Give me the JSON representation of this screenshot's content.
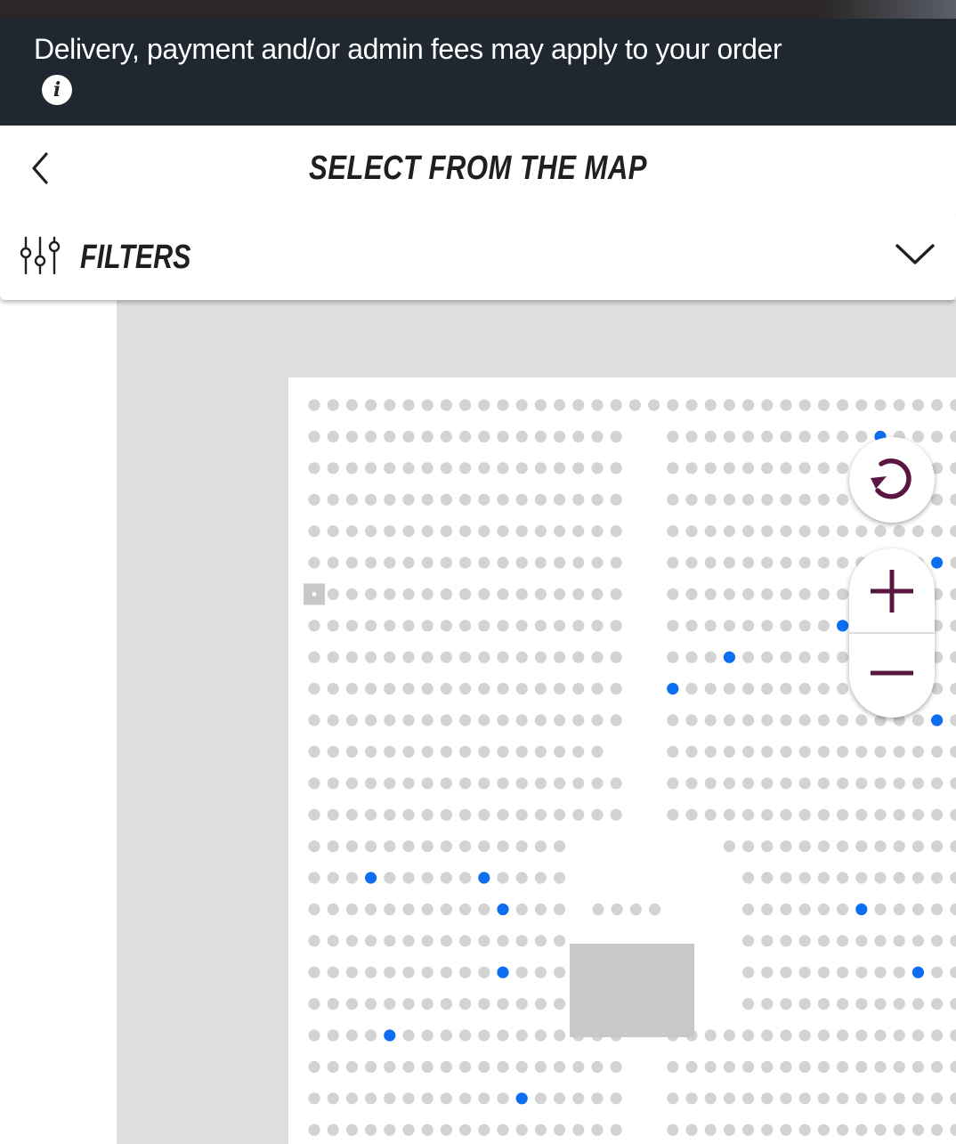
{
  "banner": {
    "text": "Delivery, payment and/or admin fees may apply to your order",
    "info_icon": "info-icon",
    "info_glyph": "i"
  },
  "header": {
    "title": "SELECT FROM THE MAP",
    "back_icon": "chevron-left-icon"
  },
  "filters": {
    "label": "FILTERS",
    "icon": "sliders-icon",
    "toggle_icon": "chevron-down-icon"
  },
  "map_controls": {
    "reset_icon": "refresh-icon",
    "zoom_in_icon": "plus-icon",
    "zoom_out_icon": "minus-icon"
  },
  "colors": {
    "banner_bg": "#1f2731",
    "seat_unavailable": "#d3d3d3",
    "seat_available": "#0d6ef0",
    "control_icon": "#5a1640",
    "map_background": "#dedede",
    "stage_block": "#c8c8c8"
  }
}
